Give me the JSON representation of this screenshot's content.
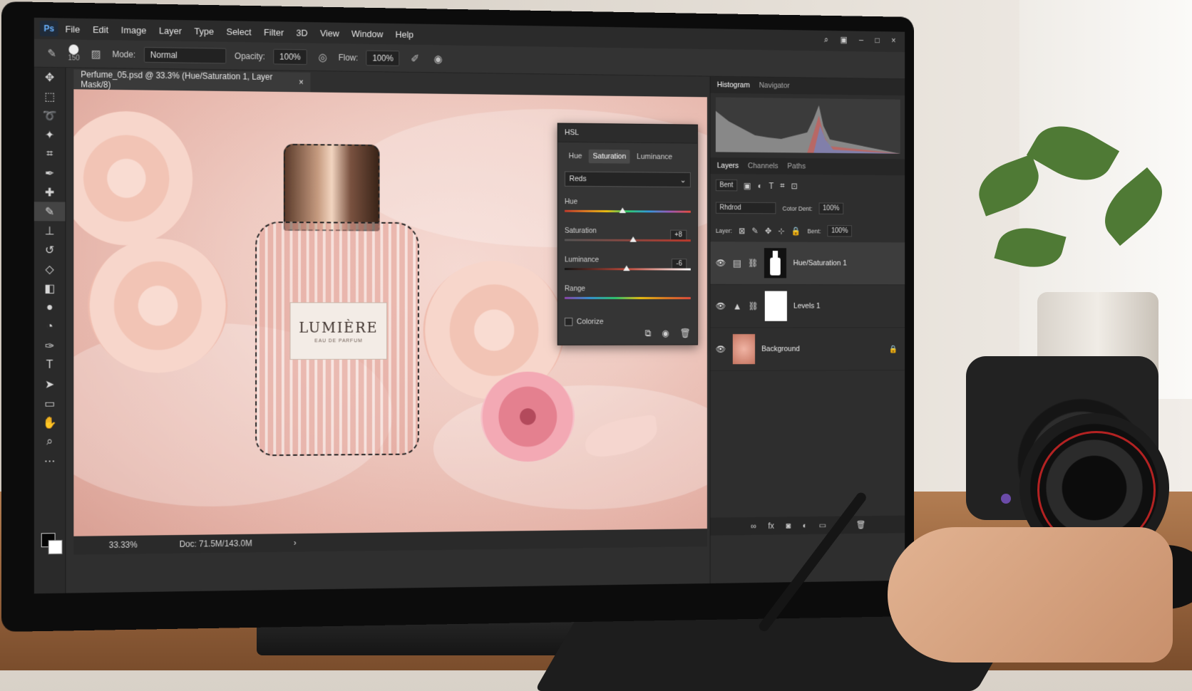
{
  "app": {
    "logo": "Ps",
    "menu": [
      "File",
      "Edit",
      "Image",
      "Layer",
      "Type",
      "Select",
      "Filter",
      "3D",
      "View",
      "Window",
      "Help"
    ]
  },
  "options_bar": {
    "brush_size": "150",
    "mode_label": "Mode:",
    "mode_value": "Normal",
    "opacity_label": "Opacity:",
    "opacity_value": "100%",
    "flow_label": "Flow:",
    "flow_value": "100%"
  },
  "document": {
    "tab_title": "Perfume_05.psd @ 33.3% (Hue/Saturation 1, Layer Mask/8)",
    "close_glyph": "×",
    "label_title": "LUMIÈRE",
    "label_subtitle": "EAU DE PARFUM"
  },
  "status": {
    "zoom": "33.33%",
    "doc_size": "Doc: 71.5M/143.0M"
  },
  "hsl_panel": {
    "title": "HSL",
    "tabs": [
      "Hue",
      "Saturation",
      "Luminance"
    ],
    "active_tab": "Saturation",
    "channel": "Reds",
    "hue_label": "Hue",
    "saturation_label": "Saturation",
    "saturation_value": "+8",
    "luminance_label": "Luminance",
    "luminance_value": "-6",
    "range_label": "Range",
    "colorize_label": "Colorize"
  },
  "right_panels": {
    "top_tabs": [
      "Histogram",
      "Navigator"
    ],
    "layer_tabs": [
      "Layers",
      "Channels",
      "Paths"
    ],
    "filter_kind": "Bent",
    "blend_mode": "Rhdrod",
    "opacity_label": "Cotor Dent:",
    "opacity_value": "100%",
    "lock_label": "Layer:",
    "fill_label": "Bent:",
    "fill_value": "100%",
    "layers": [
      {
        "name": "Hue/Saturation 1"
      },
      {
        "name": "Levels 1"
      },
      {
        "name": "Background"
      }
    ]
  },
  "colors": {
    "ui_dark": "#2f2f2f",
    "canvas_pink": "#efcbc2",
    "accent_blue": "#6ab2ff"
  }
}
